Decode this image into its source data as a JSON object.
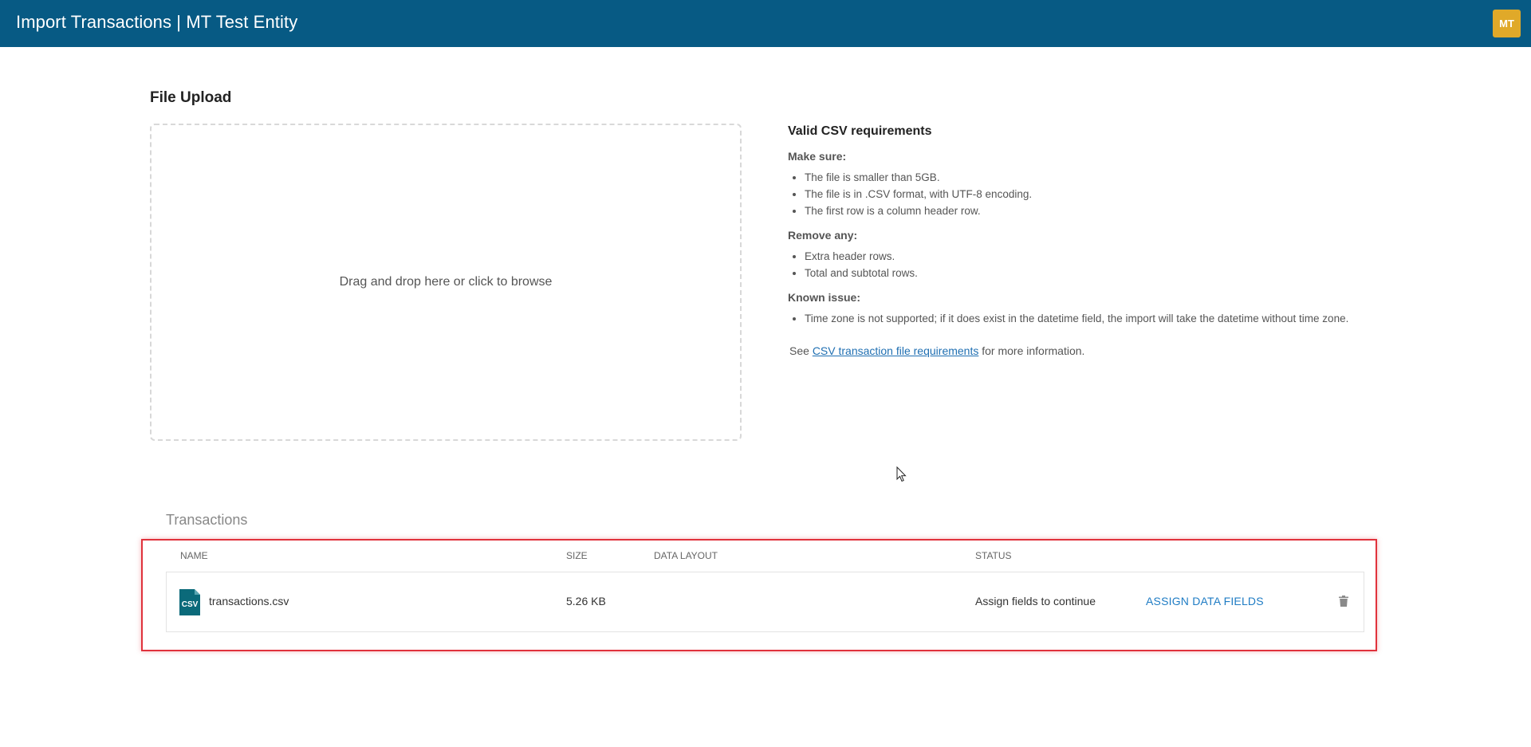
{
  "header": {
    "title": "Import Transactions | MT Test Entity",
    "avatar_initials": "MT",
    "background_color": "#075a84",
    "avatar_color": "#e0a929"
  },
  "upload": {
    "section_title": "File Upload",
    "dropzone_text": "Drag and drop here or click to browse"
  },
  "requirements": {
    "title": "Valid CSV requirements",
    "make_sure_label": "Make sure:",
    "make_sure_items": [
      "The file is smaller than 5GB.",
      "The file is in .CSV format, with UTF-8 encoding.",
      "The first row is a column header row."
    ],
    "remove_label": "Remove any:",
    "remove_items": [
      "Extra header rows.",
      "Total and subtotal rows."
    ],
    "known_issue_label": "Known issue:",
    "known_issue_items": [
      "Time zone is not supported; if it does exist in the datetime field, the import will take the datetime without time zone."
    ],
    "see_prefix": "See",
    "see_link": "CSV transaction file requirements",
    "see_suffix": "for more information."
  },
  "transactions": {
    "title": "Transactions",
    "columns": {
      "name": "Name",
      "size": "Size",
      "data_layout": "Data Layout",
      "status": "Status"
    },
    "rows": [
      {
        "icon": "csv-file-icon",
        "icon_label": "CSV",
        "name": "transactions.csv",
        "size": "5.26 KB",
        "data_layout": "",
        "status": "Assign fields to continue",
        "action": "Assign Data Fields"
      }
    ],
    "accent_color": "#1f7cc4",
    "highlight_color": "#e0323c"
  }
}
